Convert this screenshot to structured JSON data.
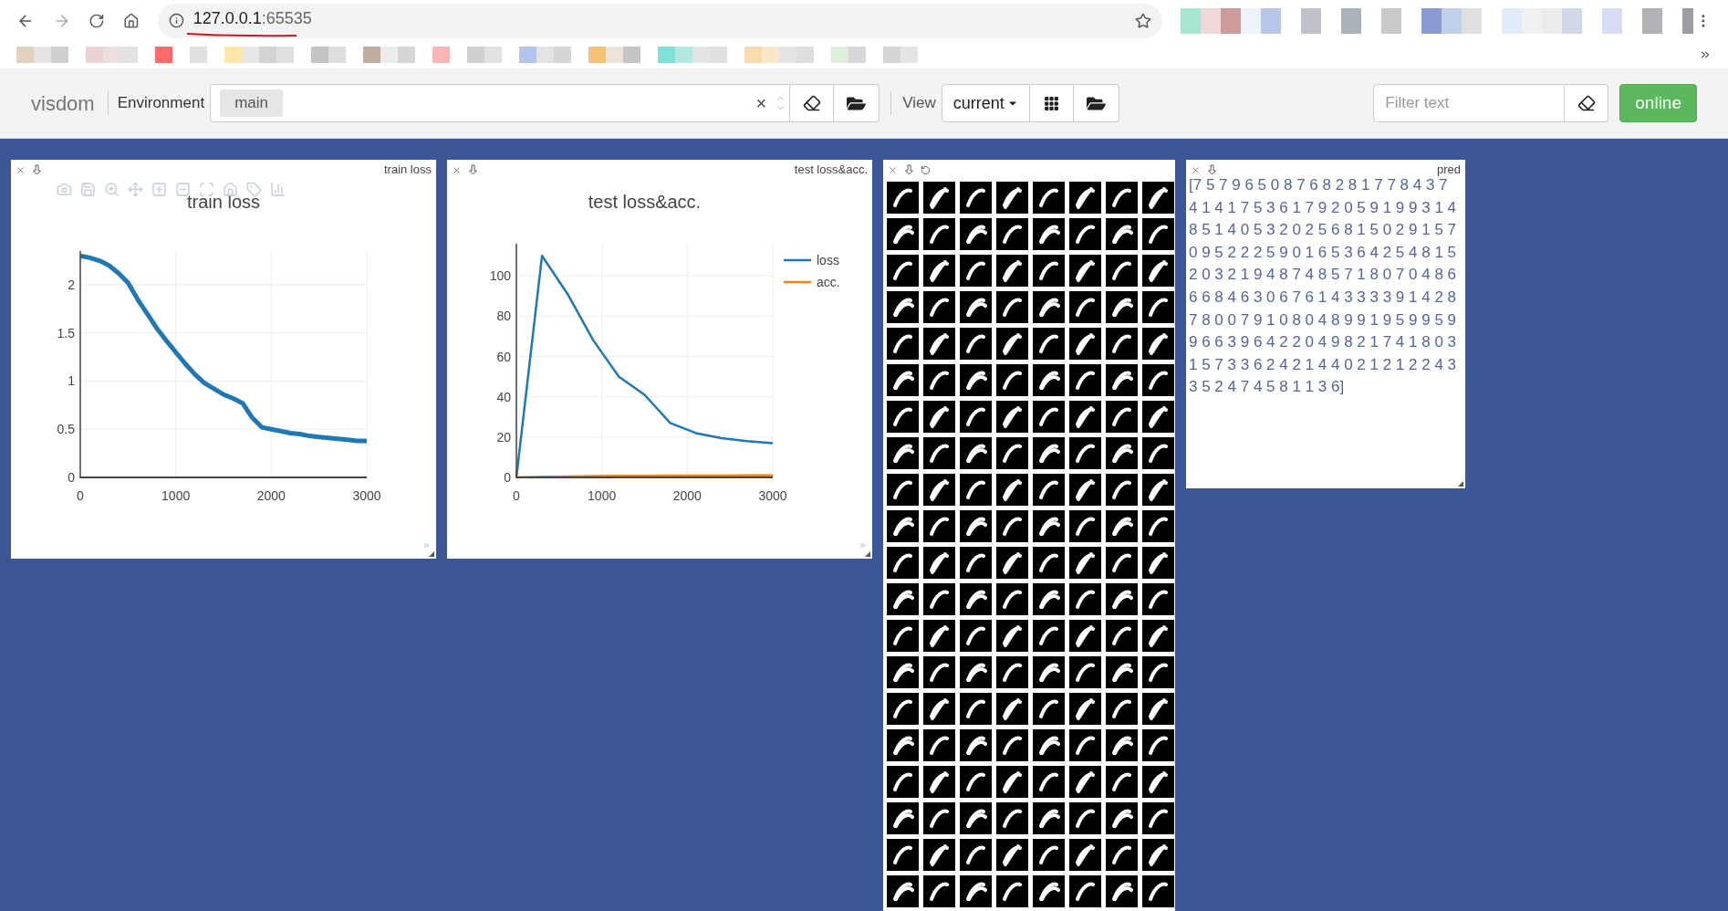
{
  "browser": {
    "url_host": "127.0.0.1",
    "url_port": ":65535"
  },
  "toolbar": {
    "logo": "visdom",
    "environment_label": "Environment",
    "environment_chips": [
      "main"
    ],
    "clear_symbol": "×",
    "view_label": "View",
    "view_select": "current",
    "filter_placeholder": "Filter text",
    "status": {
      "label": "online",
      "connected": true
    }
  },
  "panes": [
    {
      "kind": "plot",
      "title": "train loss",
      "chart_data": {
        "type": "line",
        "title": "train loss",
        "x": [
          0,
          100,
          200,
          300,
          400,
          500,
          600,
          700,
          800,
          900,
          1000,
          1100,
          1200,
          1300,
          1400,
          1500,
          1600,
          1700,
          1800,
          1900,
          2000,
          2100,
          2200,
          2300,
          2400,
          2500,
          2600,
          2700,
          2800,
          2900,
          3000
        ],
        "values": [
          2.3,
          2.28,
          2.25,
          2.2,
          2.12,
          2.02,
          1.85,
          1.7,
          1.55,
          1.42,
          1.3,
          1.18,
          1.07,
          0.98,
          0.92,
          0.86,
          0.82,
          0.77,
          0.62,
          0.52,
          0.5,
          0.48,
          0.46,
          0.45,
          0.43,
          0.42,
          0.41,
          0.4,
          0.39,
          0.38,
          0.38
        ],
        "grid": true,
        "xlim": [
          0,
          3000
        ],
        "ylim": [
          0,
          2.35
        ],
        "xticks": [
          0,
          1000,
          2000,
          3000
        ],
        "yticks": [
          {
            "value": 0,
            "label": "0"
          },
          {
            "value": 0.5,
            "label": "0.5"
          },
          {
            "value": 1,
            "label": "1"
          },
          {
            "value": 1.5,
            "label": "1.5"
          },
          {
            "value": 2,
            "label": "2"
          }
        ]
      }
    },
    {
      "kind": "plot",
      "title": "test loss&acc.",
      "chart_data": {
        "type": "line",
        "title": "test loss&acc.",
        "x": [
          0,
          300,
          600,
          900,
          1200,
          1500,
          1800,
          2100,
          2400,
          2700,
          3000
        ],
        "series": [
          {
            "name": "loss",
            "color": "#1f77b4",
            "values": [
              0,
              110,
              91,
              68,
              50,
              41,
              27,
              22,
              19.5,
              18,
              17
            ]
          },
          {
            "name": "acc.",
            "color": "#ff7f0e",
            "values": [
              0,
              0.3,
              0.5,
              0.7,
              0.8,
              0.8,
              0.9,
              0.9,
              0.9,
              1,
              1
            ]
          }
        ],
        "legend": true,
        "grid": true,
        "xlim": [
          0,
          3000
        ],
        "ylim": [
          0,
          116
        ],
        "xticks": [
          0,
          1000,
          2000,
          3000
        ],
        "yticks": [
          0,
          20,
          40,
          60,
          80,
          100
        ]
      }
    },
    {
      "kind": "images"
    },
    {
      "kind": "text",
      "title": "pred",
      "text": "[7 5 7 9 6 5 0 8 7 6 8 2 8 1 7 7 8 4 3 7 4 1 4 1 7 5 3 6 1 7 9 2 0 5 9 1 9 9 3 1 4 8 5 1 4 0 5 3 2 0 2 5 6 8 1 5 0 2 9 1 5 7 0 9 5 2 2 2 5 9 0 1 6 5 3 6 4 2 5 4 8 1 5 2 0 3 2 1 9 4 8 7 4 8 5 7 1 8 0 7 0 4 8 6 6 6 8 4 6 3 0 6 7 6 1 4 3 3 3 3 9 1 4 2 8 7 8 0 0 7 9 1 0 8 0 4 8 9 9 1 9 5 9 9 5 9 9 6 6 3 9 6 4 2 2 0 4 9 8 2 1 7 4 1 8 0 3 1 5 7 3 3 6 2 4 2 1 4 4 0 2 1 2 1 2 2 4 3 3 5 2 4 7 4 5 8 1 1 3 6]"
    }
  ]
}
